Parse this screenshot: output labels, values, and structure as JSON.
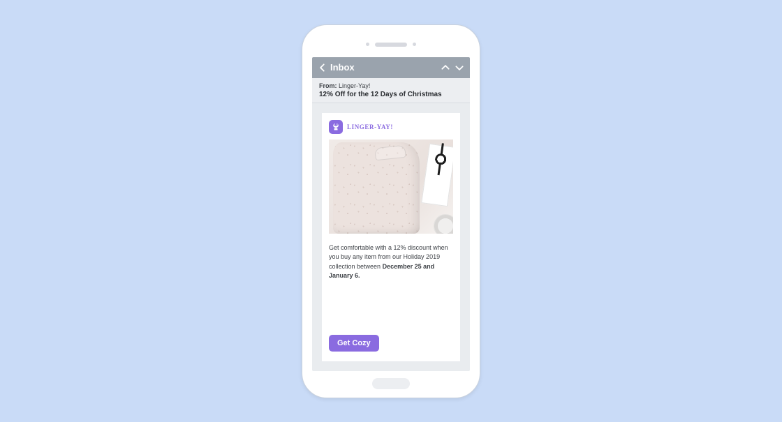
{
  "header": {
    "title": "Inbox"
  },
  "meta": {
    "from_label": "From:",
    "from_value": "Linger-Yay!",
    "subject": "12% Off for the 12 Days of Christmas"
  },
  "email": {
    "brand_name": "LINGER-YAY!",
    "body_prefix": "Get comfortable with a 12% discount when you buy any item from our Holiday 2019 collection between ",
    "body_bold": "December 25 and January 6.",
    "cta_label": "Get Cozy"
  },
  "colors": {
    "page_bg": "#c9dbf7",
    "header_bar": "#9aa3ad",
    "accent": "#8a6be0"
  }
}
